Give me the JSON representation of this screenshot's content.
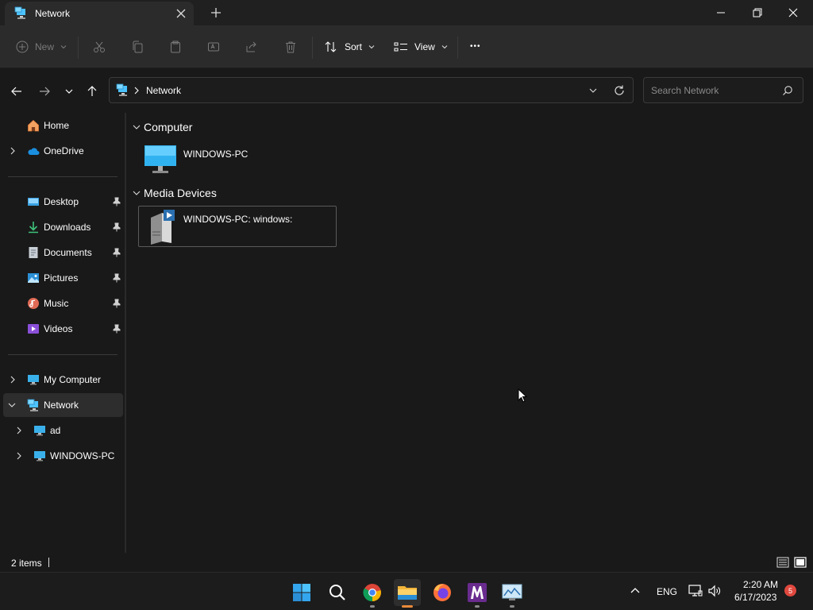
{
  "window": {
    "tab_title": "Network",
    "new_tab": "+"
  },
  "toolbar": {
    "new_label": "New",
    "sort_label": "Sort",
    "view_label": "View",
    "more_label": "•••"
  },
  "address": {
    "breadcrumb": "Network",
    "search_placeholder": "Search Network"
  },
  "sidebar": {
    "top": [
      {
        "label": "Home",
        "icon": "home-icon"
      },
      {
        "label": "OneDrive",
        "icon": "onedrive-icon"
      }
    ],
    "pinned": [
      {
        "label": "Desktop",
        "icon": "desktop-icon"
      },
      {
        "label": "Downloads",
        "icon": "downloads-icon"
      },
      {
        "label": "Documents",
        "icon": "documents-icon"
      },
      {
        "label": "Pictures",
        "icon": "pictures-icon"
      },
      {
        "label": "Music",
        "icon": "music-icon"
      },
      {
        "label": "Videos",
        "icon": "videos-icon"
      }
    ],
    "bottom": [
      {
        "label": "My Computer",
        "icon": "computer-icon"
      },
      {
        "label": "Network",
        "icon": "network-icon",
        "selected": true
      },
      {
        "label": "ad",
        "icon": "computer-icon"
      },
      {
        "label": "WINDOWS-PC",
        "icon": "computer-icon"
      }
    ]
  },
  "content": {
    "groups": [
      {
        "title": "Computer",
        "items": [
          {
            "label": "WINDOWS-PC",
            "icon": "monitor-icon"
          }
        ]
      },
      {
        "title": "Media Devices",
        "items": [
          {
            "label": "WINDOWS-PC: windows:",
            "icon": "media-server-icon"
          }
        ]
      }
    ]
  },
  "status": {
    "item_count": "2 items"
  },
  "taskbar": {
    "apps": [
      "start-icon",
      "search-icon",
      "chrome-icon",
      "file-explorer-icon",
      "firefox-icon",
      "m-app-icon",
      "monitor-app-icon"
    ],
    "language": "ENG",
    "time": "2:20 AM",
    "date": "6/17/2023",
    "notification_count": "5"
  },
  "colors": {
    "accent": "#4cc2ff",
    "badge": "#e0483e",
    "active_indicator": "#e88a3a"
  }
}
